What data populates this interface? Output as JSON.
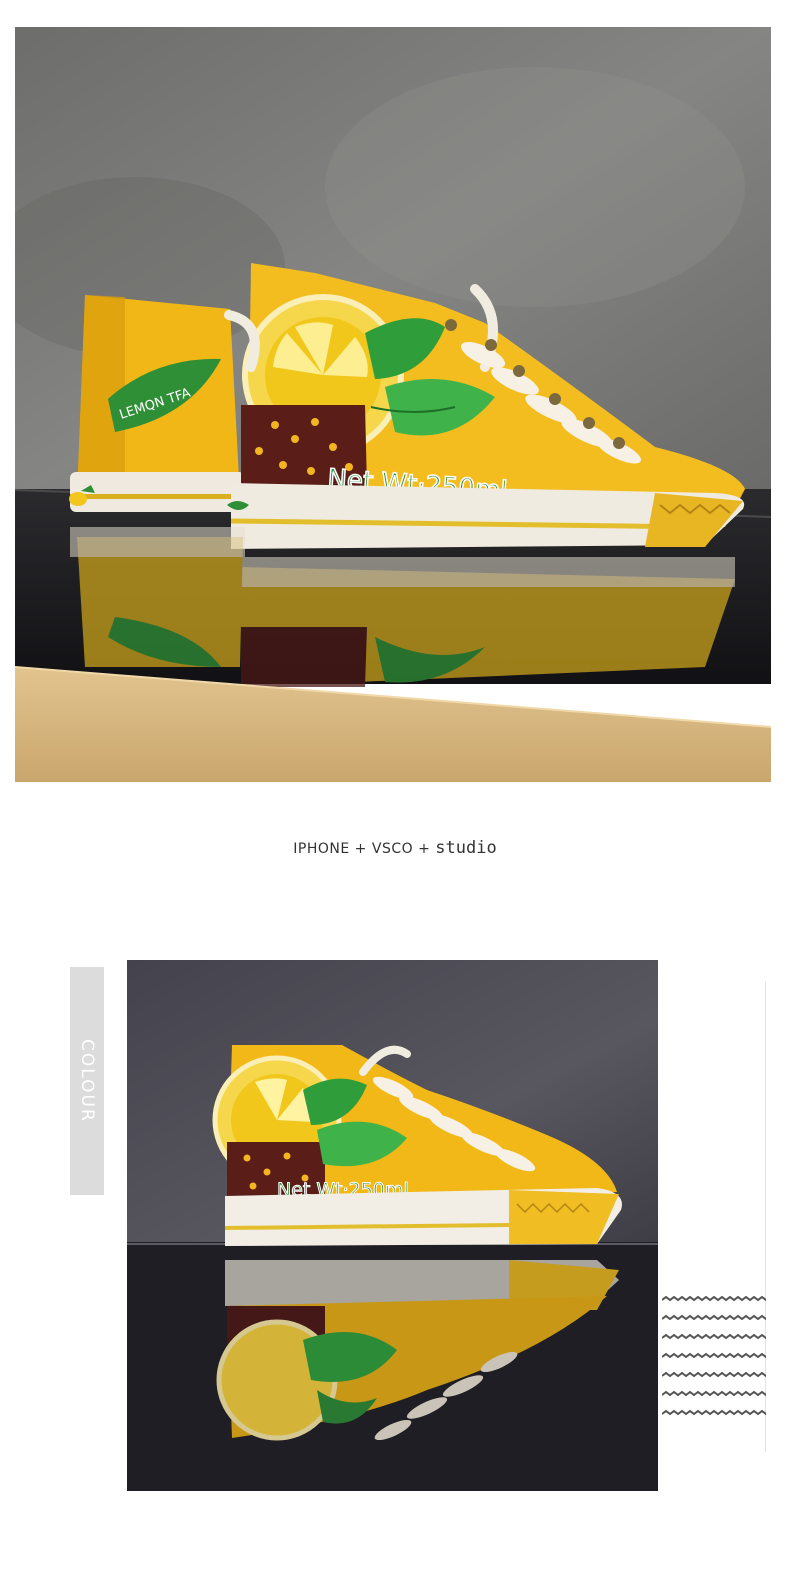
{
  "hero": {
    "shoe_print_text": "Net Wt·250ml",
    "heel_label_text": "LEMQN TFA",
    "colors": {
      "wall": "#7a7a78",
      "mirror": "#1c1c1e",
      "wood": "#d8b57e",
      "canvas": "#f2b91e",
      "leaf": "#2e9a3a",
      "tea": "#5a1d18",
      "lace": "#f1ece0"
    }
  },
  "caption": {
    "part1": "IPHONE + VSCO + ",
    "part2": "studio"
  },
  "colour_tag": {
    "label": "COLOUR",
    "color": "#dcdcdc"
  },
  "photo2": {
    "shoe_print_text": "Net Wt·250ml",
    "colors": {
      "wall": "#4d4b55",
      "mirror": "#1f1e24"
    }
  },
  "decor": {
    "wave_count": 7,
    "wave_color": "#555555"
  }
}
